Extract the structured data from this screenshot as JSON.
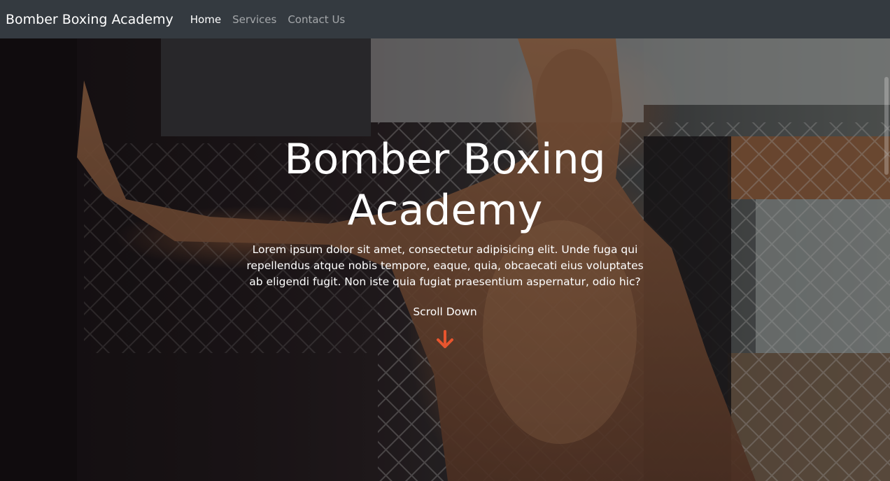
{
  "navbar": {
    "brand": "Bomber Boxing Academy",
    "links": [
      {
        "label": "Home",
        "active": true
      },
      {
        "label": "Services",
        "active": false
      },
      {
        "label": "Contact Us",
        "active": false
      }
    ],
    "background": "#343a40"
  },
  "hero": {
    "title": "Bomber Boxing Academy",
    "text": "Lorem ipsum dolor sit amet, consectetur adipisicing elit. Unde fuga qui repellendus atque nobis tempore, eaque, quia, obcaecati eius voluptates ab eligendi fugit. Non iste quia fugiat praesentium aspernatur, odio hic?",
    "scroll_label": "Scroll Down",
    "arrow_icon": "arrow-down-icon",
    "arrow_color": "#e8552e"
  }
}
